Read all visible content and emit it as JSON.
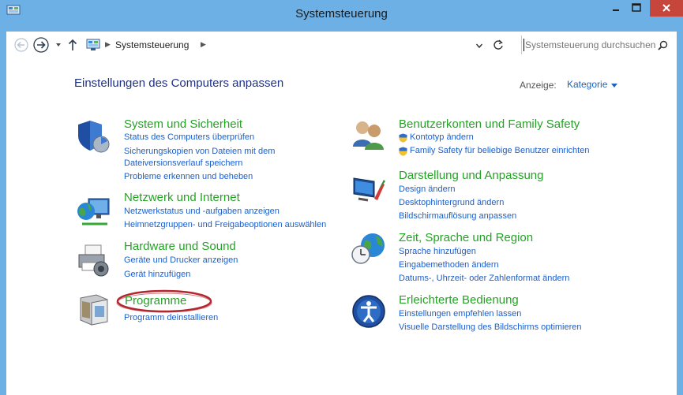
{
  "window": {
    "title": "Systemsteuerung",
    "close_color": "#c7463c",
    "frame_color": "#6cb0e5"
  },
  "toolbar": {
    "back_icon": "back-arrow-icon",
    "forward_icon": "forward-arrow-icon",
    "recent_icon": "chevron-down-icon",
    "up_icon": "up-arrow-icon",
    "breadcrumb": "Systemsteuerung",
    "refresh_icon": "refresh-icon",
    "search_placeholder": "Systemsteuerung durchsuchen"
  },
  "main": {
    "heading": "Einstellungen des Computers anpassen",
    "view_label": "Anzeige:",
    "view_value": "Kategorie",
    "title_color": "#26a127",
    "link_color": "#1c5fcb",
    "categories_left": [
      {
        "title": "System und Sicherheit",
        "icon": "shield-icon",
        "links": [
          "Status des Computers überprüfen",
          "Sicherungskopien von Dateien mit dem Dateiversionsverlauf speichern",
          "Probleme erkennen und beheben"
        ]
      },
      {
        "title": "Netzwerk und Internet",
        "icon": "network-globe-icon",
        "links": [
          "Netzwerkstatus und -aufgaben anzeigen",
          "Heimnetzgruppen- und Freigabeoptionen auswählen"
        ]
      },
      {
        "title": "Hardware und Sound",
        "icon": "printer-speaker-icon",
        "links": [
          "Geräte und Drucker anzeigen",
          "Gerät hinzufügen"
        ]
      },
      {
        "title": "Programme",
        "icon": "programs-box-icon",
        "links": [
          "Programm deinstallieren"
        ]
      }
    ],
    "categories_right": [
      {
        "title": "Benutzerkonten und Family Safety",
        "icon": "users-icon",
        "links": [
          "Kontotyp ändern",
          "Family Safety für beliebige Benutzer einrichten"
        ]
      },
      {
        "title": "Darstellung und Anpassung",
        "icon": "display-brush-icon",
        "links": [
          "Design ändern",
          "Desktophintergrund ändern",
          "Bildschirmauflösung anpassen"
        ]
      },
      {
        "title": "Zeit, Sprache und Region",
        "icon": "clock-globe-icon",
        "links": [
          "Sprache hinzufügen",
          "Eingabemethoden ändern",
          "Datums-, Uhrzeit- oder Zahlenformat ändern"
        ]
      },
      {
        "title": "Erleichterte Bedienung",
        "icon": "accessibility-icon",
        "links": [
          "Einstellungen empfehlen lassen",
          "Visuelle Darstellung des Bildschirms optimieren"
        ]
      }
    ]
  }
}
